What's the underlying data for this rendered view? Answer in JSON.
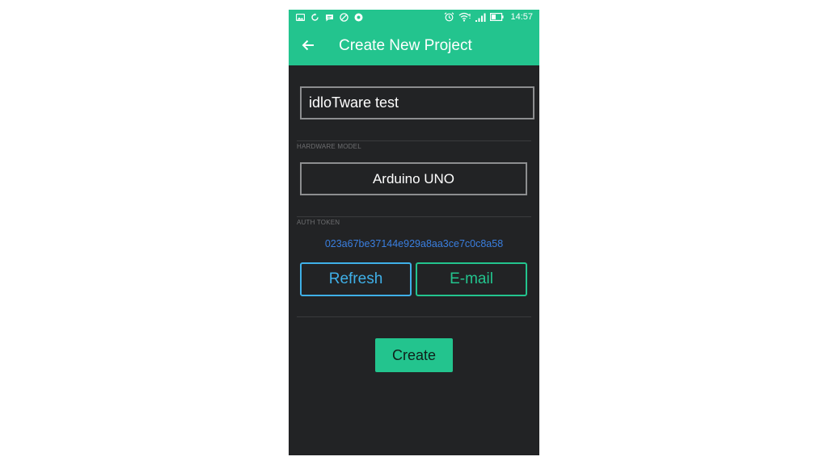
{
  "status_bar": {
    "time": "14:57",
    "icons_left": [
      "gallery-icon",
      "sync-icon",
      "message-icon",
      "block-icon",
      "chrome-icon"
    ],
    "icons_right": [
      "alarm-icon",
      "wifi-icon",
      "signal-icon",
      "battery-icon"
    ]
  },
  "header": {
    "title": "Create New Project",
    "back_icon": "arrow-left-icon"
  },
  "form": {
    "project_name_value": "idloTware test",
    "hardware_label": "HARDWARE MODEL",
    "hardware_value": "Arduino UNO",
    "auth_label": "AUTH TOKEN",
    "auth_token": "023a67be37144e929a8aa3ce7c0c8a58",
    "refresh_label": "Refresh",
    "email_label": "E-mail",
    "create_label": "Create"
  },
  "colors": {
    "accent": "#23c48e",
    "background": "#222325",
    "refresh": "#3fb0e8",
    "token": "#3a7fe0"
  }
}
